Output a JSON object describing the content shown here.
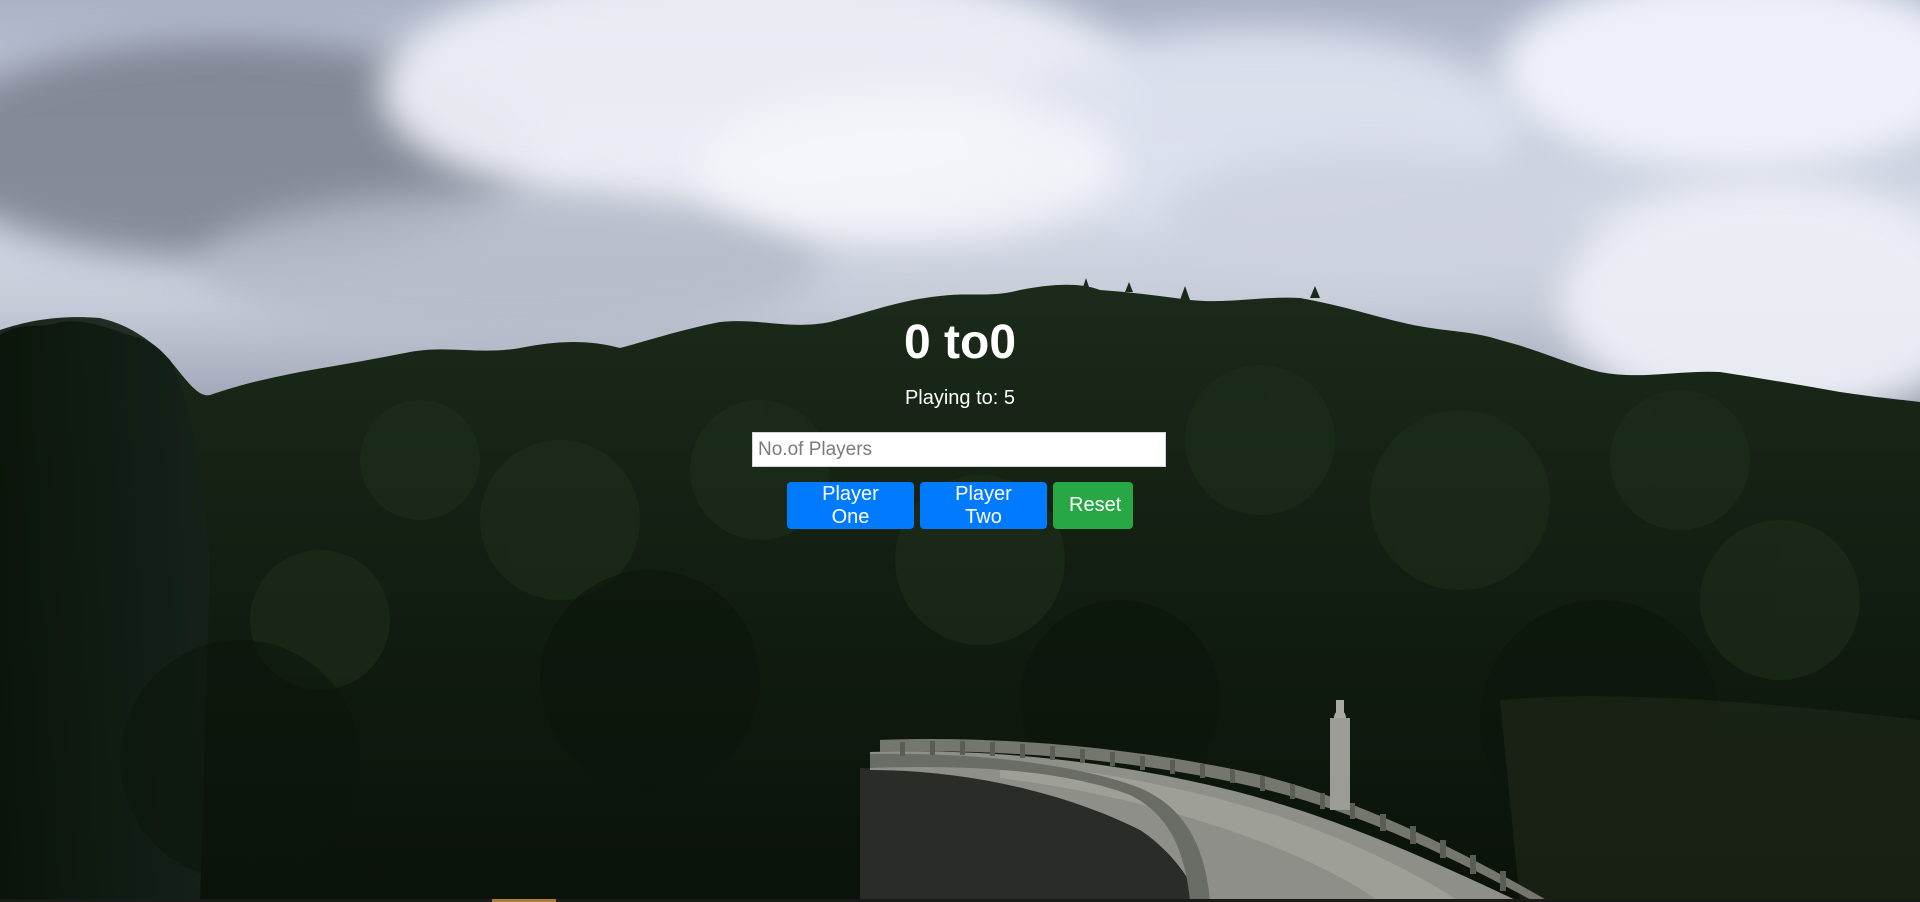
{
  "score": {
    "player_one": "0",
    "separator": " to",
    "player_two": "0"
  },
  "playing_to": {
    "label": "Playing to: ",
    "value": "5"
  },
  "players_input": {
    "placeholder": "No.of Players",
    "value": ""
  },
  "buttons": {
    "player_one": "Player One",
    "player_two": "Player Two",
    "reset": "Reset"
  },
  "colors": {
    "primary": "#007bff",
    "success": "#28a745",
    "text": "#ffffff"
  }
}
